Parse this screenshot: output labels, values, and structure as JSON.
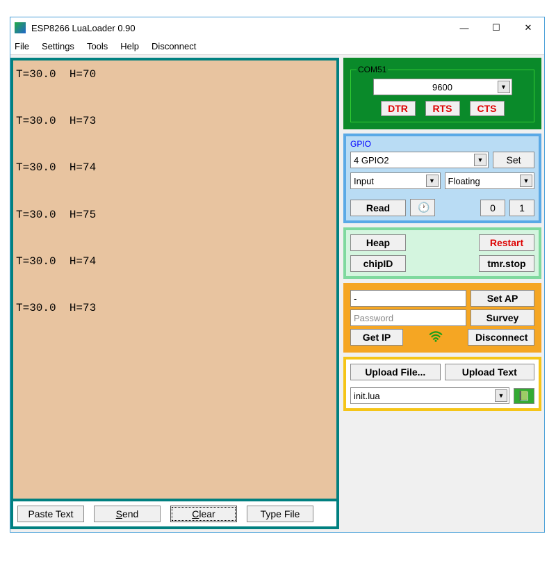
{
  "window": {
    "title": "ESP8266 LuaLoader 0.90"
  },
  "menu": {
    "file": "File",
    "settings": "Settings",
    "tools": "Tools",
    "help": "Help",
    "disconnect": "Disconnect"
  },
  "terminal": {
    "lines": "T=30.0  H=70\n\nT=30.0  H=73\n\nT=30.0  H=74\n\nT=30.0  H=75\n\nT=30.0  H=74\n\nT=30.0  H=73"
  },
  "bottom": {
    "paste": "Paste Text",
    "send": "Send",
    "clear": "Clear",
    "typefile": "Type File"
  },
  "com": {
    "legend": "COM51",
    "baud": "9600",
    "dtr": "DTR",
    "rts": "RTS",
    "cts": "CTS"
  },
  "gpio": {
    "legend": "GPIO",
    "pin": "4 GPIO2",
    "set": "Set",
    "mode": "Input",
    "pull": "Floating",
    "read": "Read",
    "zero": "0",
    "one": "1"
  },
  "sys": {
    "heap": "Heap",
    "chipid": "chipID",
    "restart": "Restart",
    "tmrstop": "tmr.stop"
  },
  "wifi": {
    "ssid": "-",
    "password_placeholder": "Password",
    "setap": "Set AP",
    "survey": "Survey",
    "getip": "Get IP",
    "disconnect": "Disconnect"
  },
  "upload": {
    "file": "Upload File...",
    "text": "Upload Text",
    "filename": "init.lua"
  }
}
